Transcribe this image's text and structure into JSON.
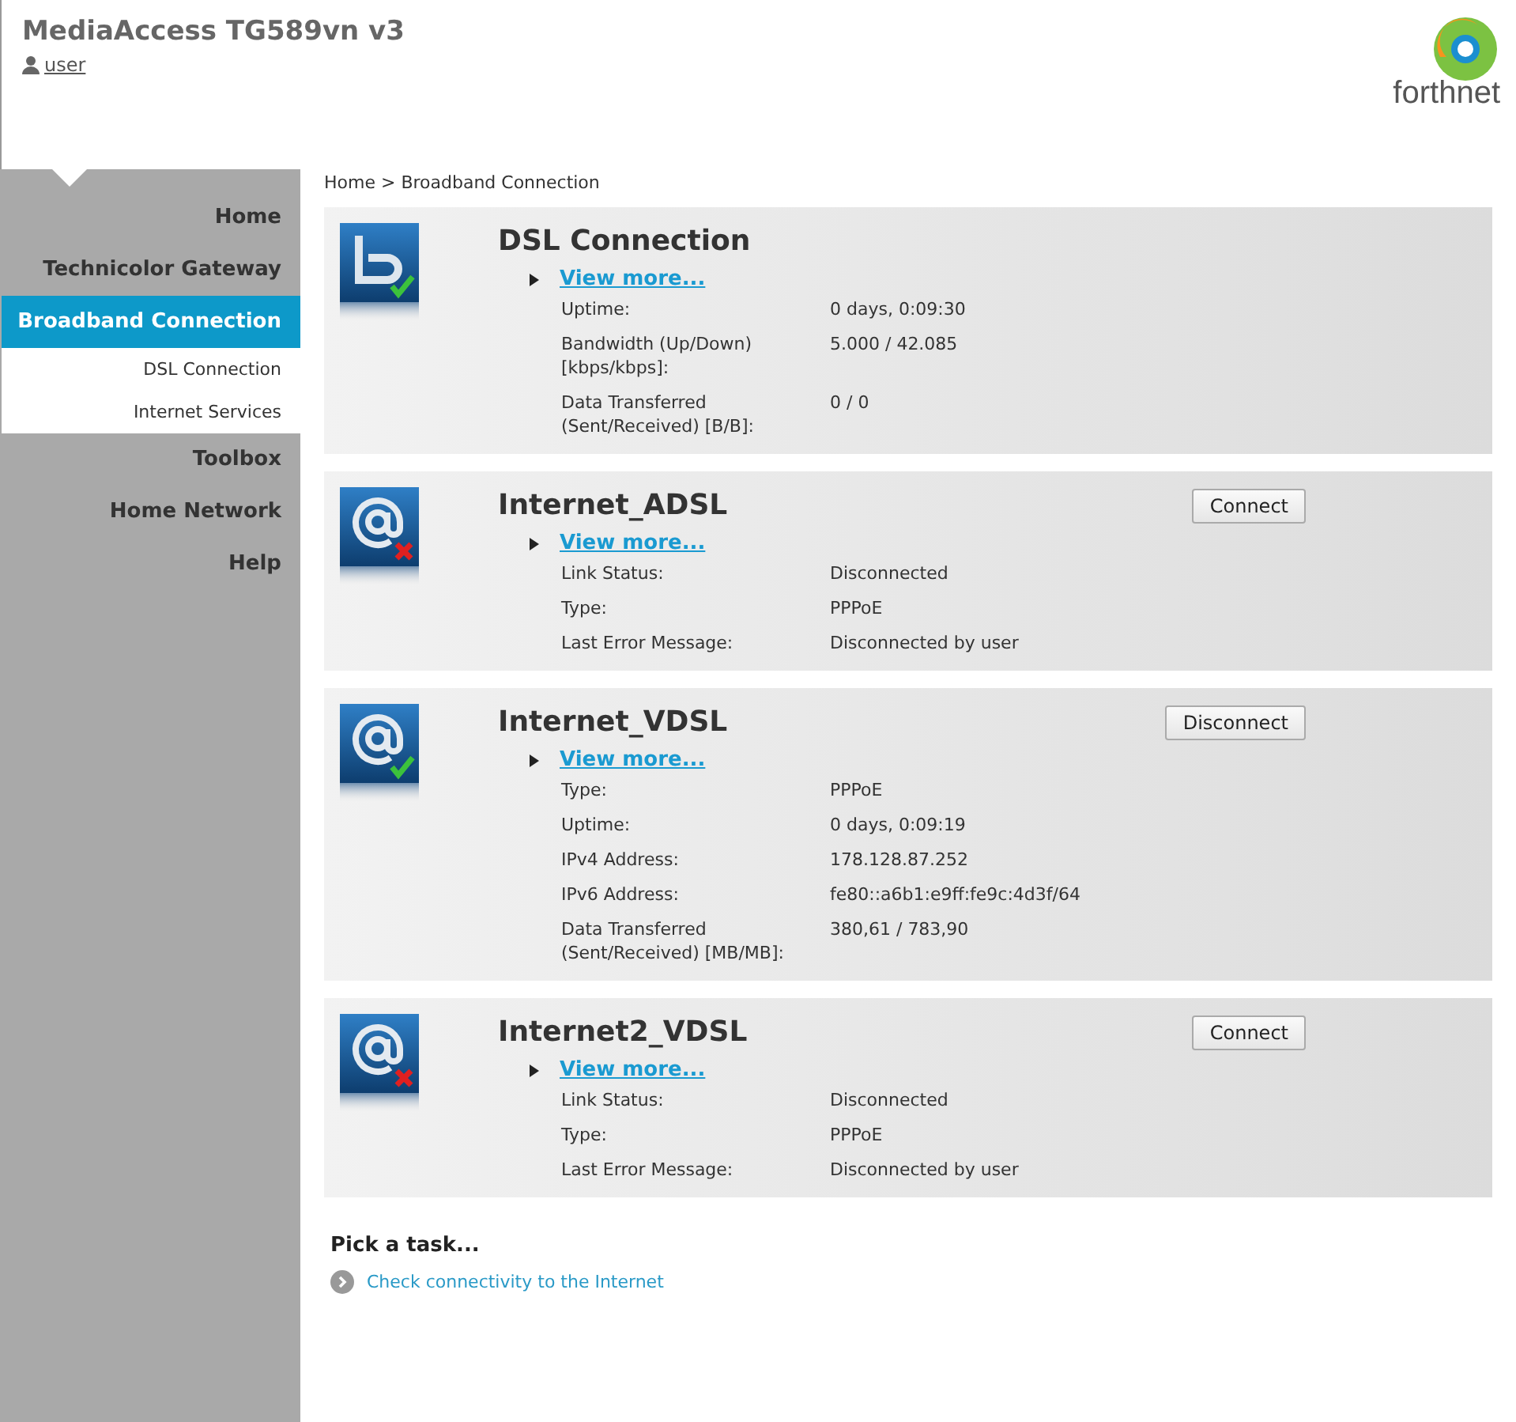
{
  "header": {
    "title": "MediaAccess TG589vn v3",
    "user": "user",
    "logo_text": "forthnet"
  },
  "sidebar": {
    "items": [
      {
        "label": "Home",
        "kind": "top",
        "selected": false
      },
      {
        "label": "Technicolor Gateway",
        "kind": "top",
        "selected": false
      },
      {
        "label": "Broadband Connection",
        "kind": "top",
        "selected": true
      },
      {
        "label": "DSL Connection",
        "kind": "sub",
        "selected": false
      },
      {
        "label": "Internet Services",
        "kind": "sub",
        "selected": false
      },
      {
        "label": "Toolbox",
        "kind": "top",
        "selected": false
      },
      {
        "label": "Home Network",
        "kind": "top",
        "selected": false
      },
      {
        "label": "Help",
        "kind": "top",
        "selected": false
      }
    ]
  },
  "breadcrumb": "Home > Broadband Connection",
  "cards": [
    {
      "title": "DSL Connection",
      "kind": "dsl",
      "connected": true,
      "view_more": "View more...",
      "rows": [
        {
          "label": "Uptime:",
          "value": "0 days, 0:09:30"
        },
        {
          "label": "Bandwidth (Up/Down) [kbps/kbps]:",
          "value": "5.000 / 42.085"
        },
        {
          "label": "Data Transferred (Sent/Received) [B/B]:",
          "value": "0 / 0"
        }
      ]
    },
    {
      "title": "Internet_ADSL",
      "kind": "internet",
      "connected": false,
      "button": "Connect",
      "view_more": "View more...",
      "rows": [
        {
          "label": "Link Status:",
          "value": "Disconnected"
        },
        {
          "label": "Type:",
          "value": "PPPoE"
        },
        {
          "label": "Last Error Message:",
          "value": "Disconnected by user"
        }
      ]
    },
    {
      "title": "Internet_VDSL",
      "kind": "internet",
      "connected": true,
      "button": "Disconnect",
      "view_more": "View more...",
      "rows": [
        {
          "label": "Type:",
          "value": "PPPoE"
        },
        {
          "label": "Uptime:",
          "value": "0 days, 0:09:19"
        },
        {
          "label": "IPv4 Address:",
          "value": "178.128.87.252"
        },
        {
          "label": "IPv6 Address:",
          "value": "fe80::a6b1:e9ff:fe9c:4d3f/64"
        },
        {
          "label": "Data Transferred (Sent/Received) [MB/MB]:",
          "value": "380,61 / 783,90"
        }
      ]
    },
    {
      "title": "Internet2_VDSL",
      "kind": "internet",
      "connected": false,
      "button": "Connect",
      "view_more": "View more...",
      "rows": [
        {
          "label": "Link Status:",
          "value": "Disconnected"
        },
        {
          "label": "Type:",
          "value": "PPPoE"
        },
        {
          "label": "Last Error Message:",
          "value": "Disconnected by user"
        }
      ]
    }
  ],
  "tasks": {
    "title": "Pick a task...",
    "items": [
      "Check connectivity to the Internet"
    ]
  }
}
